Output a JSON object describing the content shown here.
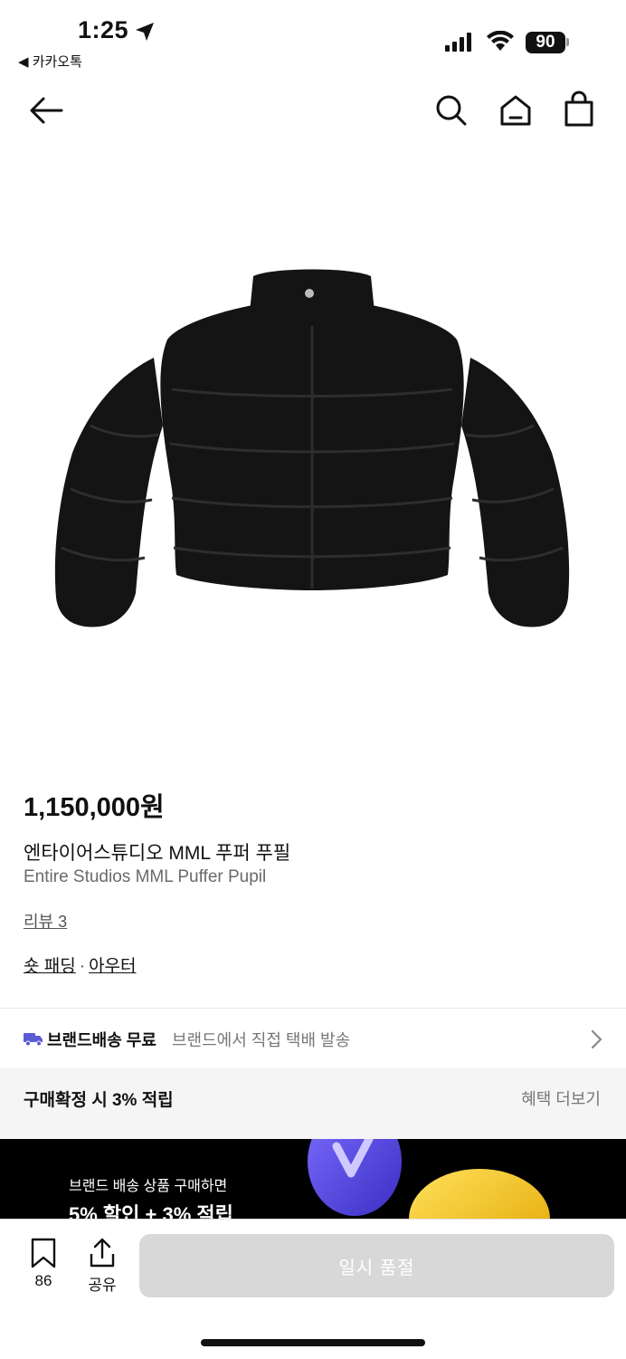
{
  "status_bar": {
    "time": "1:25",
    "back_app": "◀ 카카오톡",
    "battery": "90"
  },
  "product": {
    "price": "1,150,000원",
    "name_ko": "엔타이어스튜디오 MML 푸퍼 푸필",
    "name_en": "Entire Studios MML Puffer Pupil",
    "review": "리뷰 3",
    "category_1": "숏 패딩",
    "category_sep": "·",
    "category_2": "아우터"
  },
  "shipping": {
    "bold": "브랜드배송 무료",
    "light": "브랜드에서 직접 택배 발송"
  },
  "points": {
    "left": "구매확정 시 3% 적립",
    "right": "혜택 더보기"
  },
  "banner": {
    "sub": "브랜드 배송 상품 구매하면",
    "main": "5% 할인 + 3% 적립"
  },
  "bottom_bar": {
    "bookmark_count": "86",
    "share_label": "공유",
    "cta_label": "일시 품절"
  },
  "colors": {
    "accent_truck": "#5b5bd6",
    "soldout_bg": "#d8d8d8",
    "coin_purple": "#5a4ee8",
    "coin_yellow": "#f5c518"
  },
  "icons": [
    "location-arrow-icon",
    "signal-icon",
    "wifi-icon",
    "back-arrow-icon",
    "search-icon",
    "home-icon",
    "cart-icon",
    "truck-icon",
    "chevron-right-icon",
    "bookmark-icon",
    "share-icon"
  ]
}
